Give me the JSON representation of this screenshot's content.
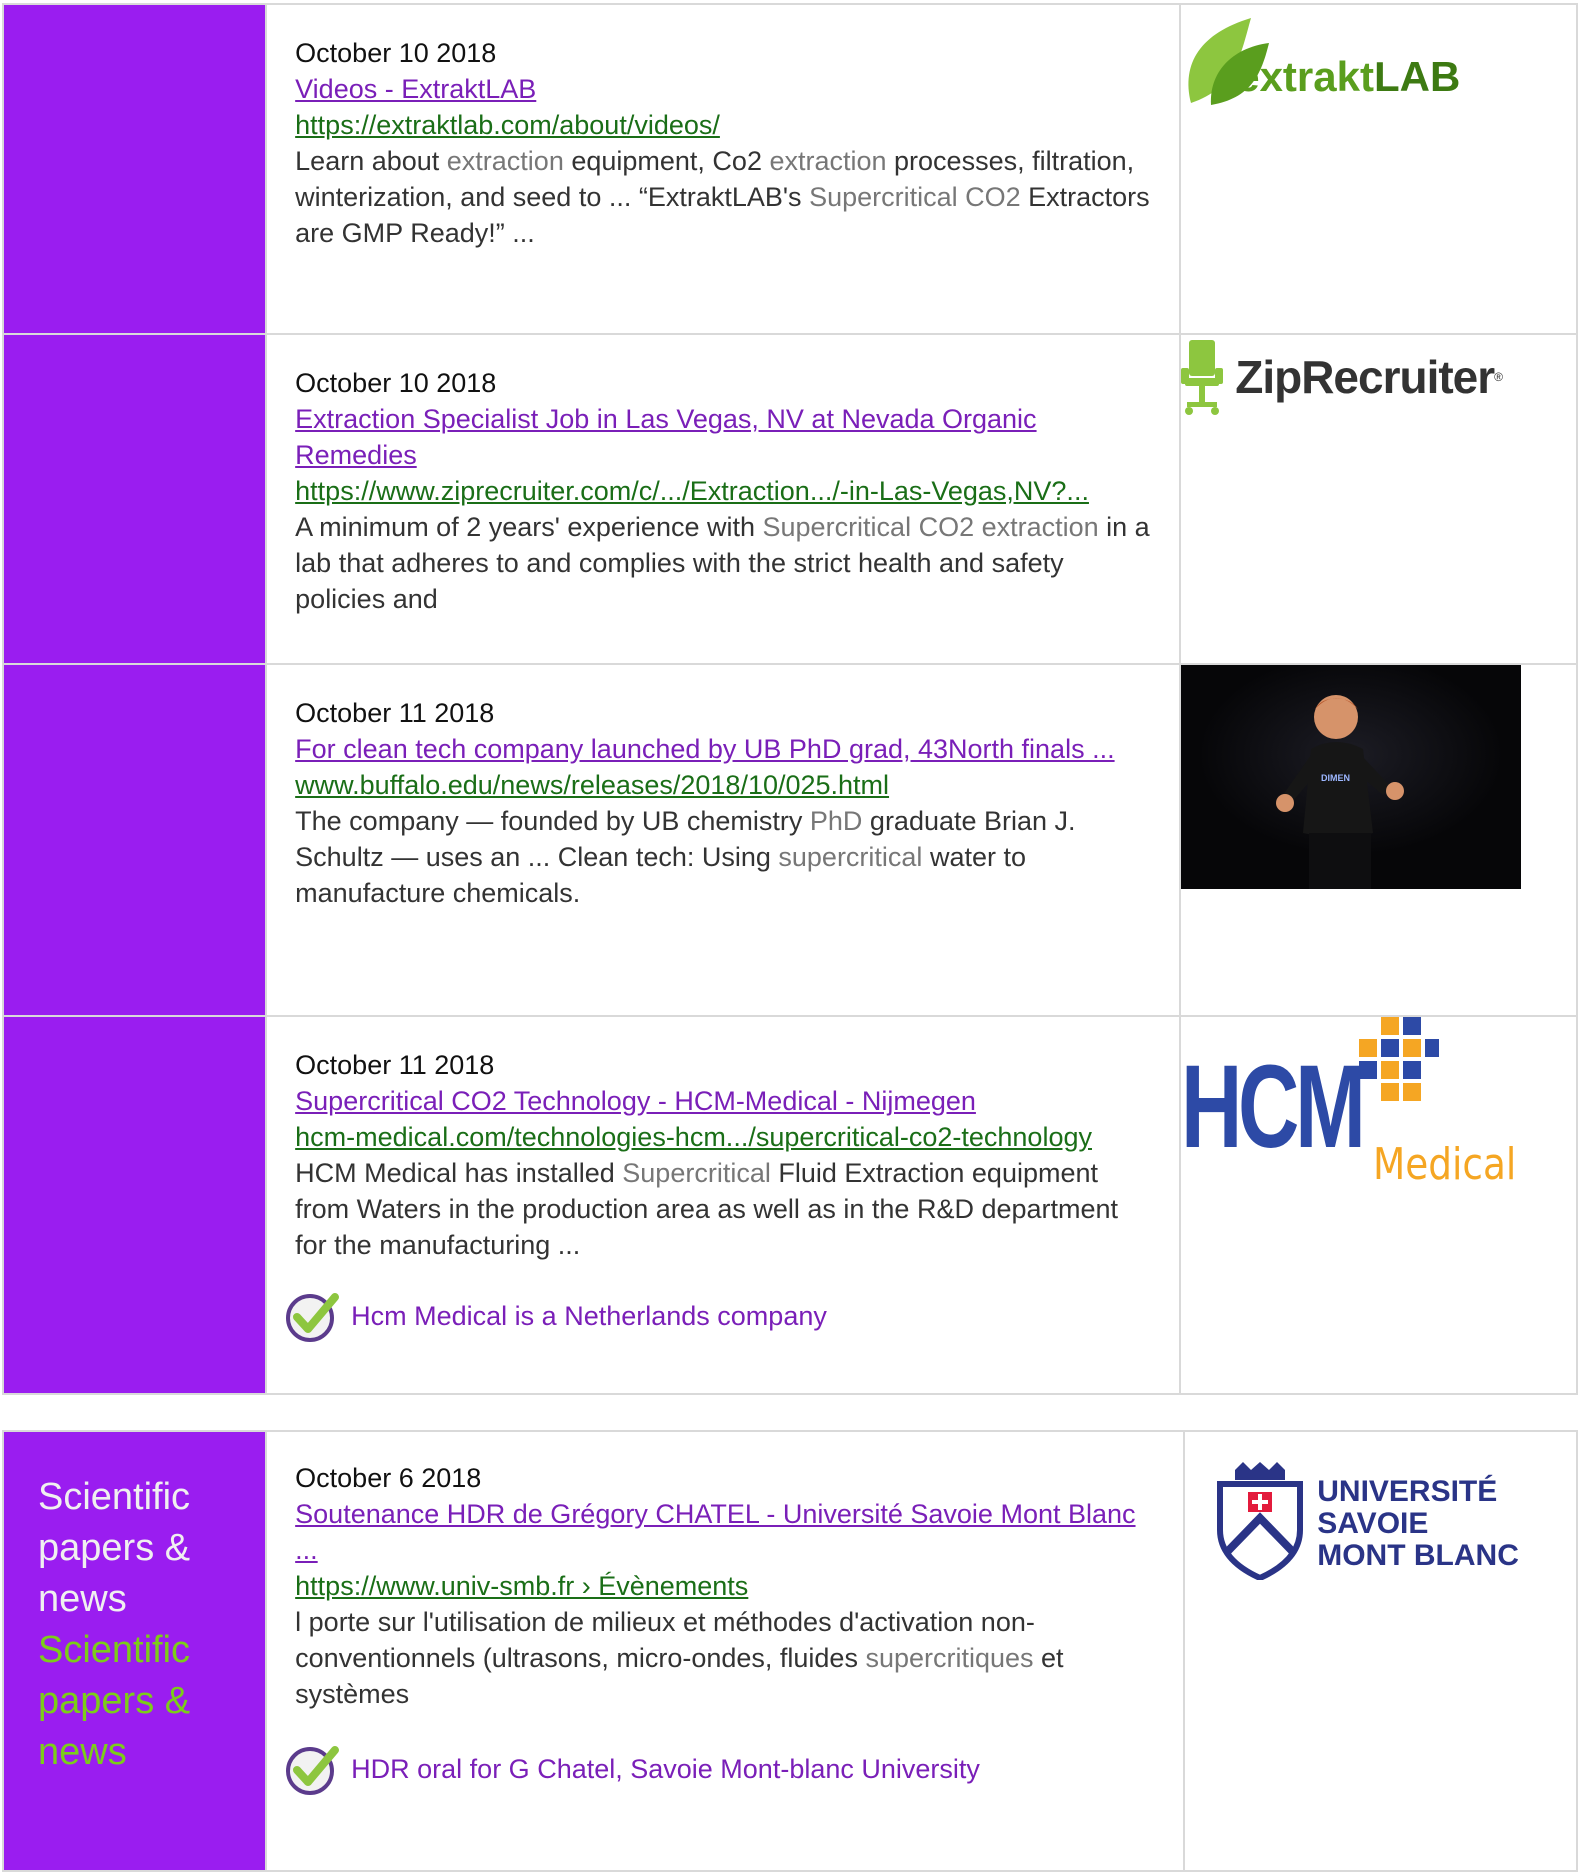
{
  "rows": [
    {
      "date": "October 10 2018",
      "title": "Videos - ExtraktLAB",
      "url": "https://extraktlab.com/about/videos/",
      "snippet": [
        {
          "t": " Learn about ",
          "h": false
        },
        {
          "t": "extraction",
          "h": true
        },
        {
          "t": " equipment, Co2 ",
          "h": false
        },
        {
          "t": "extraction",
          "h": true
        },
        {
          "t": " processes, filtration, winterization, and seed to ... “ExtraktLAB's ",
          "h": false
        },
        {
          "t": "Supercritical CO2",
          "h": true
        },
        {
          "t": " Extractors are GMP Ready!” ...",
          "h": false
        }
      ],
      "logo": {
        "name": "extraktlab-logo",
        "text_a": "extrakt",
        "text_b": "LAB"
      }
    },
    {
      "date": "October 10 2018",
      "title": "Extraction Specialist Job in Las Vegas, NV at Nevada Organic Remedies",
      "url": "https://www.ziprecruiter.com/c/.../Extraction.../-in-Las-Vegas,NV?...",
      "snippet": [
        {
          "t": " A minimum of 2 years' experience with ",
          "h": false
        },
        {
          "t": "Supercritical CO2 extraction",
          "h": true
        },
        {
          "t": " in a lab that adheres to and complies with the strict health and safety policies and",
          "h": false
        }
      ],
      "logo": {
        "name": "ziprecruiter-logo",
        "text": "ZipRecruiter",
        "reg": "®"
      }
    },
    {
      "date": "October 11 2018",
      "title": "For clean tech company launched by UB PhD grad, 43North finals ...",
      "url": "www.buffalo.edu/news/releases/2018/10/025.html",
      "snippet": [
        {
          "t": "The company — founded by UB chemistry ",
          "h": false
        },
        {
          "t": "PhD",
          "h": true
        },
        {
          "t": " graduate Brian J. Schultz — uses an ... Clean tech: Using ",
          "h": false
        },
        {
          "t": "supercritical",
          "h": true
        },
        {
          "t": " water to manufacture chemicals.",
          "h": false
        }
      ],
      "photo": {
        "name": "speaker-photo",
        "shirt_text": "DIMEN"
      }
    },
    {
      "date": "October 11 2018",
      "title": "Supercritical CO2 Technology - HCM-Medical - Nijmegen",
      "url": "hcm-medical.com/technologies-hcm.../supercritical-co2-technology",
      "snippet": [
        {
          "t": " HCM Medical has installed ",
          "h": false
        },
        {
          "t": "Supercritical",
          "h": true
        },
        {
          "t": " Fluid Extraction equipment from Waters in the production area as well as in the R&D department for the manufacturing ...",
          "h": false
        }
      ],
      "note": "Hcm Medical is a Netherlands company",
      "logo": {
        "name": "hcm-medical-logo",
        "text_a": "HCM",
        "text_b": "Medical"
      }
    }
  ],
  "section2": {
    "category_white": "Scientific papers & news",
    "category_green": "Scientific papers & news",
    "date": "October 6 2018",
    "title": "Soutenance HDR de Grégory CHATEL - Université Savoie Mont Blanc ...",
    "url": "https://www.univ-smb.fr › Évènements",
    "snippet": [
      {
        "t": "l porte sur l'utilisation de milieux et méthodes d'activation non-conventionnels (ultrasons, micro-ondes, fluides ",
        "h": false
      },
      {
        "t": "supercritiques",
        "h": true
      },
      {
        "t": " et systèmes",
        "h": false
      }
    ],
    "note": "HDR oral for G Chatel, Savoie Mont-blanc University",
    "logo": {
      "name": "universite-savoie-mont-blanc-logo",
      "line1": "UNIVERSITÉ",
      "line2": "SAVOIE",
      "line3": "MONT BLANC"
    }
  },
  "colors": {
    "category_bg": "#9a1df0",
    "title_link": "#7a1fb8",
    "url_link": "#1a6e17",
    "category_green": "#7ccc1a"
  }
}
